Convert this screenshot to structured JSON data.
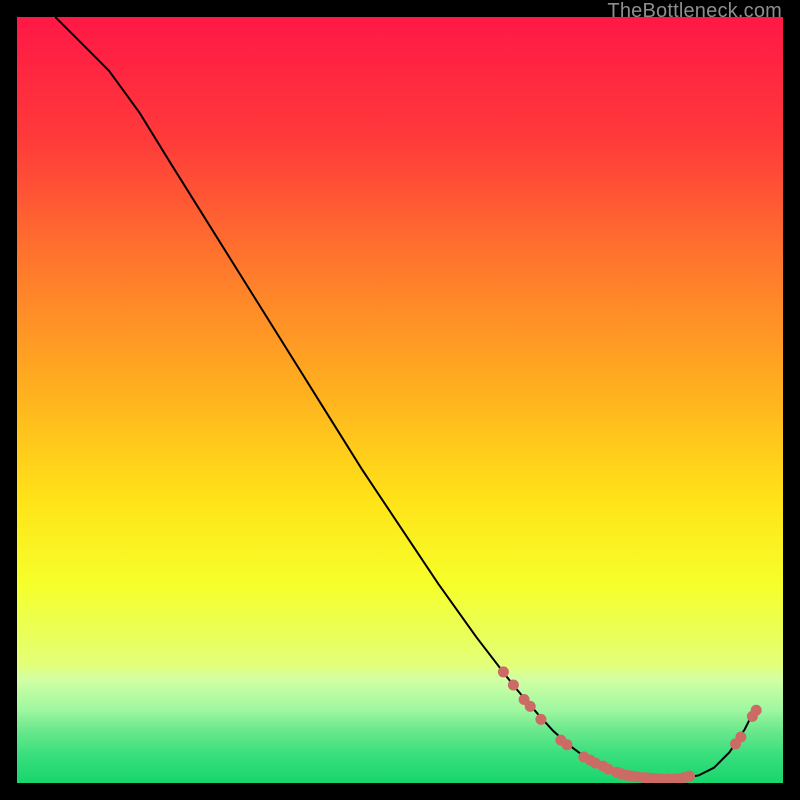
{
  "watermark": "TheBottleneck.com",
  "chart_data": {
    "type": "line",
    "title": "",
    "xlabel": "",
    "ylabel": "",
    "xlim": [
      0,
      100
    ],
    "ylim": [
      0,
      100
    ],
    "grid": false,
    "series": [
      {
        "name": "curve",
        "x": [
          5,
          8,
          12,
          16,
          20,
          25,
          30,
          35,
          40,
          45,
          50,
          55,
          60,
          65,
          68,
          70,
          72,
          74,
          76,
          78,
          80,
          82,
          84,
          85.6,
          87,
          89,
          91,
          93,
          95,
          96
        ],
        "y": [
          100,
          97,
          93,
          87.5,
          81,
          73,
          65,
          57,
          49,
          41,
          33.5,
          26,
          19,
          12.5,
          9,
          6.8,
          5,
          3.5,
          2.4,
          1.5,
          1,
          0.7,
          0.5,
          0.5,
          0.6,
          1,
          2,
          4,
          7,
          9
        ]
      }
    ],
    "markers": [
      {
        "x": 63.5,
        "y": 14.5
      },
      {
        "x": 64.8,
        "y": 12.8
      },
      {
        "x": 66.2,
        "y": 10.9
      },
      {
        "x": 67.0,
        "y": 10.0
      },
      {
        "x": 68.4,
        "y": 8.3
      },
      {
        "x": 71.0,
        "y": 5.6
      },
      {
        "x": 71.8,
        "y": 5.0
      },
      {
        "x": 74.0,
        "y": 3.4
      },
      {
        "x": 74.8,
        "y": 3.0
      },
      {
        "x": 75.5,
        "y": 2.6
      },
      {
        "x": 76.5,
        "y": 2.2
      },
      {
        "x": 77.2,
        "y": 1.8
      },
      {
        "x": 78.3,
        "y": 1.4
      },
      {
        "x": 78.9,
        "y": 1.2
      },
      {
        "x": 79.7,
        "y": 1.0
      },
      {
        "x": 80.3,
        "y": 0.9
      },
      {
        "x": 81.0,
        "y": 0.8
      },
      {
        "x": 81.8,
        "y": 0.7
      },
      {
        "x": 82.4,
        "y": 0.65
      },
      {
        "x": 83.0,
        "y": 0.6
      },
      {
        "x": 83.6,
        "y": 0.55
      },
      {
        "x": 84.3,
        "y": 0.5
      },
      {
        "x": 85.0,
        "y": 0.5
      },
      {
        "x": 85.8,
        "y": 0.5
      },
      {
        "x": 86.5,
        "y": 0.55
      },
      {
        "x": 87.1,
        "y": 0.7
      },
      {
        "x": 87.8,
        "y": 0.9
      },
      {
        "x": 93.8,
        "y": 5.1
      },
      {
        "x": 94.5,
        "y": 6.0
      },
      {
        "x": 96.0,
        "y": 8.7
      },
      {
        "x": 96.5,
        "y": 9.5
      }
    ],
    "gradient_stops": [
      {
        "pct": 0,
        "color": "#ff1846"
      },
      {
        "pct": 16,
        "color": "#ff3a3a"
      },
      {
        "pct": 33,
        "color": "#ff7a2c"
      },
      {
        "pct": 50,
        "color": "#ffb41e"
      },
      {
        "pct": 63,
        "color": "#ffe318"
      },
      {
        "pct": 74,
        "color": "#f6ff2a"
      },
      {
        "pct": 80,
        "color": "#eaff55"
      },
      {
        "pct": 84.5,
        "color": "#e4ff79"
      },
      {
        "pct": 86.5,
        "color": "#d1ffa4"
      },
      {
        "pct": 90.5,
        "color": "#9ef7a0"
      },
      {
        "pct": 93,
        "color": "#6de88e"
      },
      {
        "pct": 96,
        "color": "#3de07e"
      },
      {
        "pct": 100,
        "color": "#17d56c"
      }
    ],
    "marker_color": "#cc6b66",
    "line_color": "#000000"
  }
}
